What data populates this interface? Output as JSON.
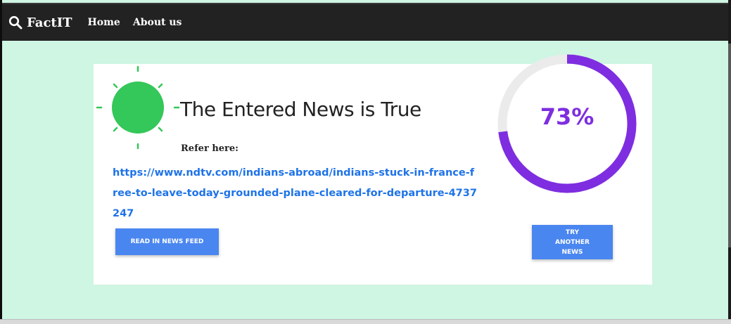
{
  "navbar": {
    "brand": "FactIT",
    "links": [
      "Home",
      "About us"
    ]
  },
  "result": {
    "verdict": "The Entered News is True",
    "refer_label": "Refer here:",
    "source_url": "https://www.ndtv.com/indians-abroad/indians-stuck-in-france-free-to-leave-today-grounded-plane-cleared-for-departure-4737247",
    "confidence_label": "73%",
    "confidence_value": 0.73
  },
  "buttons": {
    "read_feed": "READ IN NEWS FEED",
    "try_another": "TRY ANOTHER NEWS"
  },
  "colors": {
    "background": "#cff5e3",
    "navbar": "#222222",
    "sun": "#34c759",
    "gauge_fill": "#7e2ee0",
    "gauge_track": "#ebebeb",
    "link": "#1e73e8",
    "button": "#4a86f0"
  }
}
